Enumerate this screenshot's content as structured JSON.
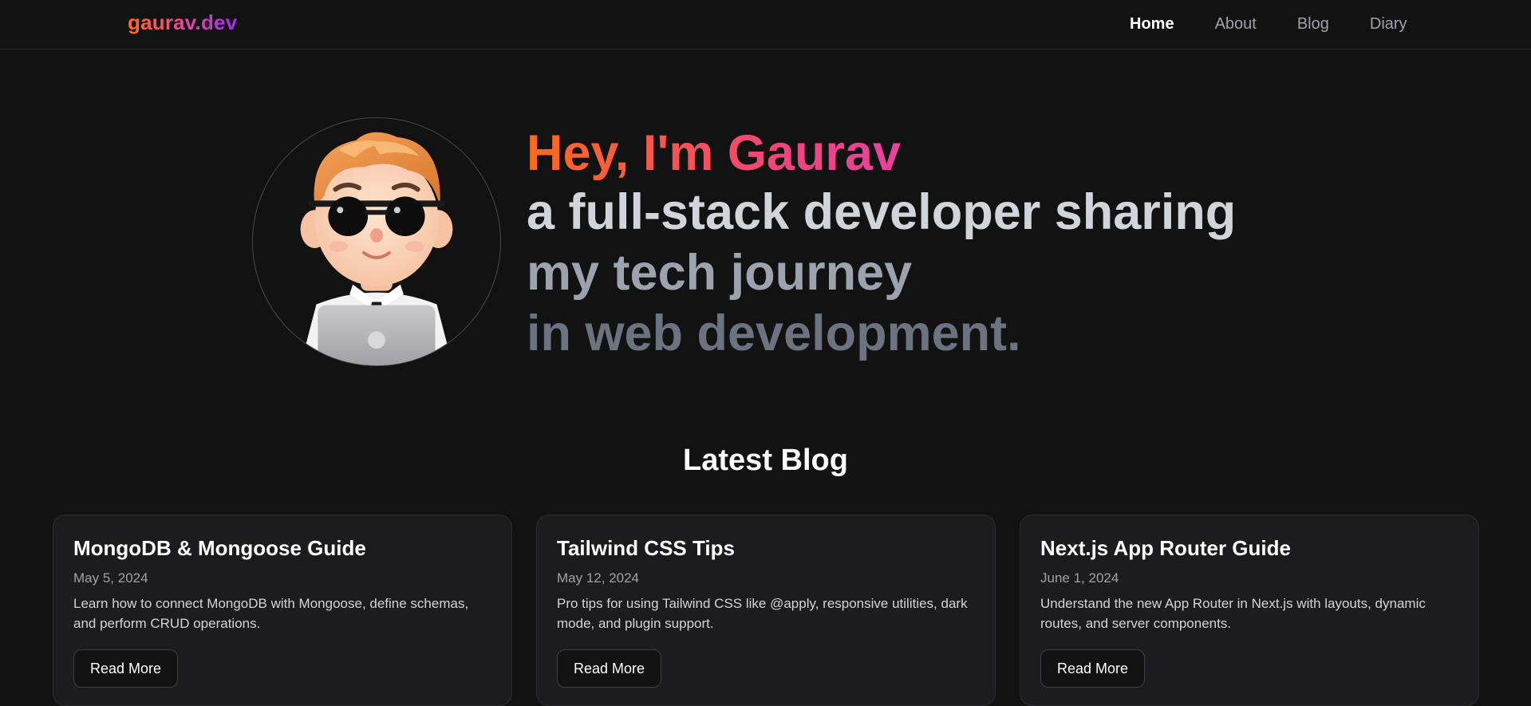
{
  "nav": {
    "logo": "gaurav.dev",
    "links": [
      {
        "label": "Home",
        "active": true
      },
      {
        "label": "About",
        "active": false
      },
      {
        "label": "Blog",
        "active": false
      },
      {
        "label": "Diary",
        "active": false
      }
    ]
  },
  "hero": {
    "title": "Hey, I'm Gaurav",
    "line1": "a full-stack developer sharing",
    "line2": "my tech journey",
    "line3": "in web development."
  },
  "blog": {
    "heading": "Latest Blog",
    "posts": [
      {
        "title": "MongoDB & Mongoose Guide",
        "date": "May 5, 2024",
        "description": "Learn how to connect MongoDB with Mongoose, define schemas, and perform CRUD operations.",
        "cta": "Read More"
      },
      {
        "title": "Tailwind CSS Tips",
        "date": "May 12, 2024",
        "description": "Pro tips for using Tailwind CSS like @apply, responsive utilities, dark mode, and plugin support.",
        "cta": "Read More"
      },
      {
        "title": "Next.js App Router Guide",
        "date": "June 1, 2024",
        "description": "Understand the new App Router in Next.js with layouts, dynamic routes, and server components.",
        "cta": "Read More"
      }
    ]
  },
  "colors": {
    "background": "#121212",
    "card": "#1c1c1e",
    "gradient_start": "#ff6a1a",
    "gradient_mid": "#ec4899",
    "gradient_end": "#a02cf5"
  }
}
